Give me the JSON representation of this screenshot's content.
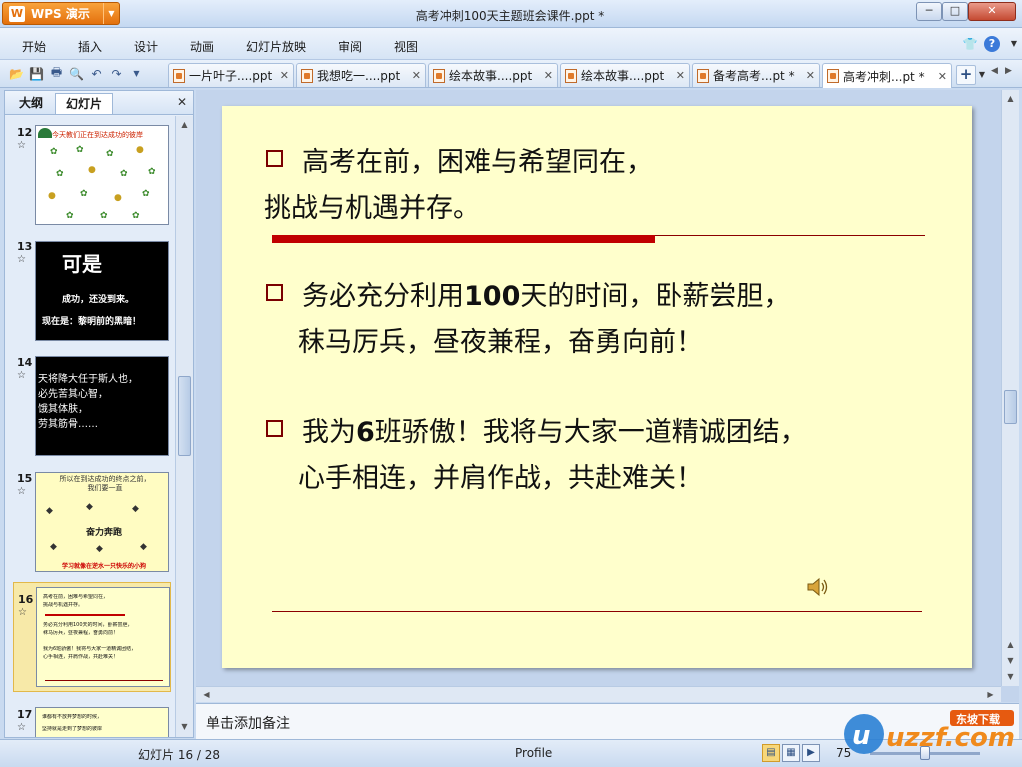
{
  "window": {
    "app_button": "WPS 演示",
    "app_logo_glyph": "W",
    "title": "高考冲刺100天主题班会课件.ppt *"
  },
  "menu": {
    "items": [
      "开始",
      "插入",
      "设计",
      "动画",
      "幻灯片放映",
      "审阅",
      "视图"
    ]
  },
  "tabs": [
    {
      "label": "一片叶子....ppt",
      "active": false
    },
    {
      "label": "我想吃一....ppt",
      "active": false
    },
    {
      "label": "绘本故事....ppt",
      "active": false
    },
    {
      "label": "绘本故事....ppt",
      "active": false
    },
    {
      "label": "备考高考...pt *",
      "active": false
    },
    {
      "label": "高考冲刺...pt *",
      "active": true
    }
  ],
  "left_panel": {
    "tabs": [
      "大纲",
      "幻灯片"
    ],
    "active_tab": "幻灯片",
    "thumbnails": [
      {
        "number": "12",
        "title": "今天教们正在到达成功的彼岸"
      },
      {
        "number": "13",
        "big": "可是",
        "line1": "成功，还没到来。",
        "line2": "现在是：黎明前的黑暗！"
      },
      {
        "number": "14",
        "text": "天将降大任于斯人也，\n必先苦其心智，\n饿其体肤，\n劳其筋骨……"
      },
      {
        "number": "15",
        "head": "所以在到达成功的终点之前，\n我们要一直",
        "mid": "奋力奔跑",
        "foot": "学习就像在逆水一只快乐的小狗"
      },
      {
        "number": "16",
        "lines": [
          "高考在前，困难与希望同在，",
          "挑战与机遇并存。",
          "务必充分利用100天的时间，卧薪尝胆，",
          "秣马厉兵，昼夜兼程，奋勇向前！",
          "我为6班骄傲！我将与大家一道精诚团结，",
          "心手相连，并肩作战，共赴难关！"
        ]
      },
      {
        "number": "17",
        "lines": [
          "谁都有不放弃梦想的时候，",
          "坚持就是走到了梦想的彼岸"
        ]
      }
    ],
    "selected": "16"
  },
  "slide": {
    "b1_line1": "高考在前，困难与希望同在，",
    "b1_line2": "挑战与机遇并存。",
    "b2_pre": "务必充分利用",
    "b2_num": "100",
    "b2_post": "天的时间，卧薪尝胆，",
    "b2_line2": "秣马厉兵，昼夜兼程，奋勇向前！",
    "b3_pre": "我为",
    "b3_num": "6",
    "b3_post": "班骄傲！我将与大家一道精诚团结，",
    "b3_line2": "心手相连，并肩作战，共赴难关！"
  },
  "notes": {
    "placeholder": "单击添加备注"
  },
  "status": {
    "slide_counter": "幻灯片 16 / 28",
    "theme": "Profile",
    "zoom": "75"
  },
  "watermark": {
    "brand": "uzzf.com",
    "tag": "东坡下载"
  },
  "colors": {
    "app_orange": "#e3700d",
    "slide_bg": "#ffffcc",
    "accent_red": "#c00000",
    "rule_dark_red": "#8b0000"
  }
}
